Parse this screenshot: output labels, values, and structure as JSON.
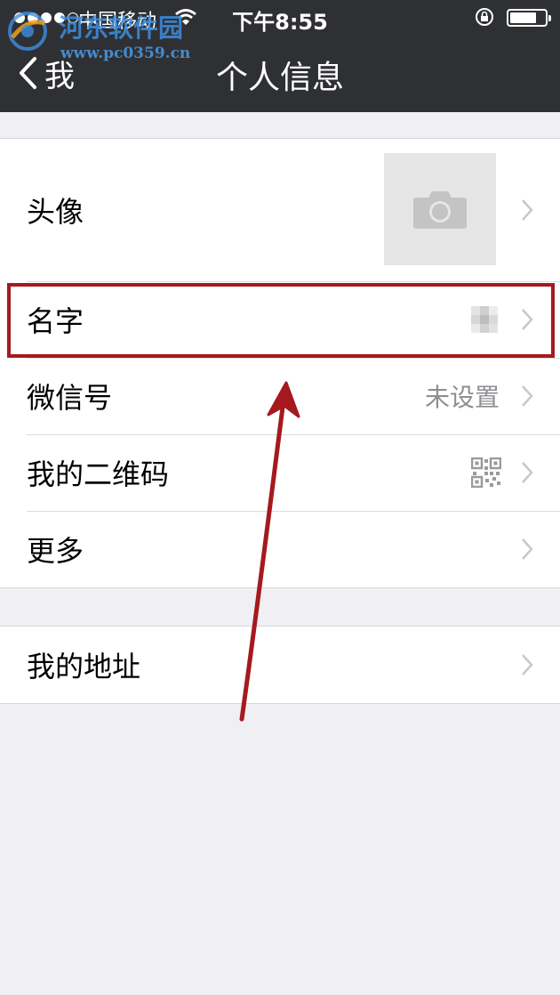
{
  "status_bar": {
    "carrier": "中国移动",
    "time": "下午8:55",
    "battery_level": 0.75
  },
  "watermark": {
    "title": "河东软件园",
    "url": "www.pc0359.cn"
  },
  "nav": {
    "back_label": "我",
    "title": "个人信息"
  },
  "profile_items": [
    {
      "label": "头像"
    },
    {
      "label": "名字"
    },
    {
      "label": "微信号",
      "value": "未设置"
    },
    {
      "label": "我的二维码"
    },
    {
      "label": "更多"
    }
  ],
  "address_item": {
    "label": "我的地址"
  },
  "colors": {
    "header_bg": "#2f3034",
    "page_bg": "#efeff4",
    "annotation": "#a5191f",
    "watermark": "#3d8fe0"
  }
}
